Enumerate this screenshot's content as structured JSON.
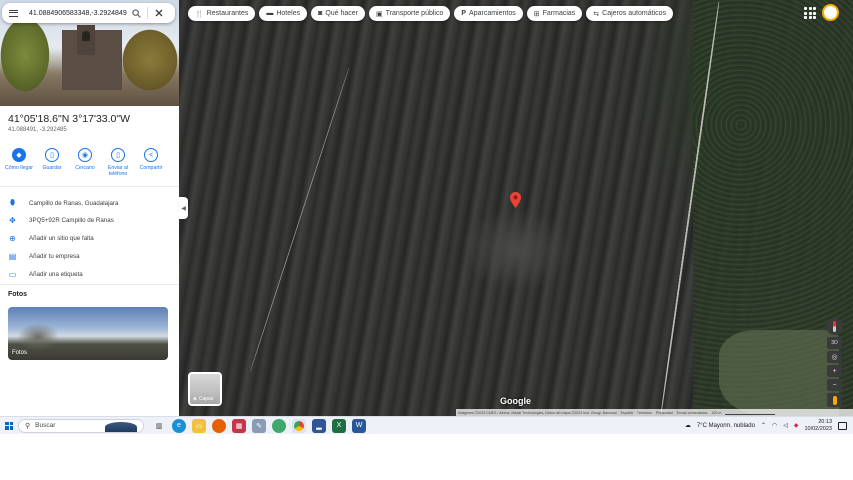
{
  "search": {
    "value": "41.0884906583348,-3.292484948",
    "search_icon": "search-icon",
    "close_icon": "close-icon"
  },
  "place": {
    "coords_dms": "41°05'18.6\"N 3°17'33.0\"W",
    "coords_decimal": "41.088491, -3.292485"
  },
  "actions": [
    {
      "label": "Cómo llegar",
      "icon": "directions-icon"
    },
    {
      "label": "Guardar",
      "icon": "bookmark-icon"
    },
    {
      "label": "Cercano",
      "icon": "nearby-icon"
    },
    {
      "label": "Enviar al teléfono",
      "icon": "phone-icon"
    },
    {
      "label": "Compartir",
      "icon": "share-icon"
    }
  ],
  "info": [
    {
      "text": "Campillo de Ranas, Guadalajara",
      "icon": "location-pin-icon"
    },
    {
      "text": "3PQ5+92R Campillo de Ranas",
      "icon": "plus-code-icon"
    },
    {
      "text": "Añadir un sitio que falta",
      "icon": "add-place-icon"
    },
    {
      "text": "Añadir tu empresa",
      "icon": "business-icon"
    },
    {
      "text": "Añadir una etiqueta",
      "icon": "label-icon"
    }
  ],
  "fotos": {
    "title": "Fotos",
    "card_label": "Fotos"
  },
  "chips": [
    {
      "label": "Restaurantes",
      "icon": "restaurant-icon"
    },
    {
      "label": "Hoteles",
      "icon": "hotel-icon"
    },
    {
      "label": "Qué hacer",
      "icon": "camera-icon"
    },
    {
      "label": "Transporte público",
      "icon": "bus-icon"
    },
    {
      "label": "Aparcamientos",
      "icon": "parking-icon"
    },
    {
      "label": "Farmacias",
      "icon": "pharmacy-icon"
    },
    {
      "label": "Cajeros automáticos",
      "icon": "atm-icon"
    }
  ],
  "map": {
    "layers_label": "Capas",
    "google": "Google",
    "attribution": "Imágenes ©2023 CNES / Airbus, Maxar Technologies, Datos del mapa ©2023 Inst. Geogr. Nacional",
    "links": [
      "España",
      "Términos",
      "Privacidad",
      "Enviar comentarios"
    ],
    "scale": "100 m",
    "zoom_in": "+",
    "zoom_out": "−"
  },
  "taskbar": {
    "search_placeholder": "Buscar",
    "weather": "7°C  Mayorm. nublado",
    "time": "20:13",
    "date": "10/02/2023"
  },
  "colors": {
    "accent": "#1a73e8",
    "pin": "#ea4335"
  }
}
